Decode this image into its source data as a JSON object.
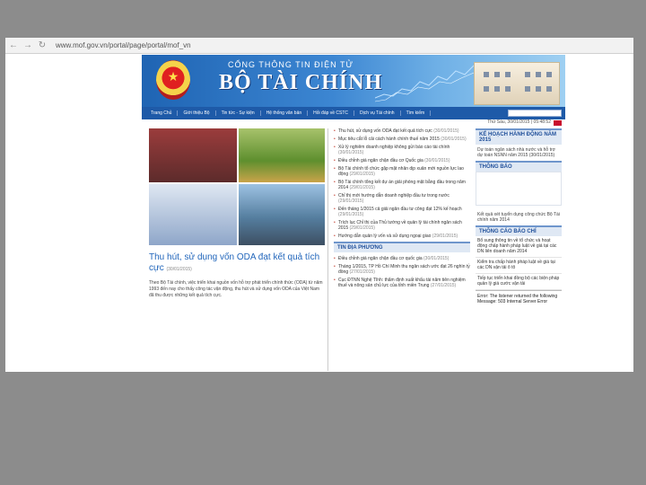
{
  "browser": {
    "url": "www.mof.gov.vn/portal/page/portal/mof_vn"
  },
  "banner": {
    "subtitle": "CỔNG THÔNG TIN ĐIỆN TỬ",
    "title": "BỘ TÀI CHÍNH"
  },
  "menu": {
    "items": [
      "Trang Chủ",
      "Giới thiệu Bộ",
      "Tin tức - Sự kiện",
      "Hệ thống văn bản",
      "Hỏi đáp về CSTC",
      "Dịch vụ Tài chính"
    ],
    "search_label": "Tìm kiếm"
  },
  "date": "Thứ Sáu, 30/01/2015 | 05:48:52",
  "lead": {
    "title": "Thu hút, sử dụng vốn ODA đạt kết quả tích cực",
    "date": "(30/01/2015)",
    "desc": "Theo Bộ Tài chính, việc triển khai nguồn vốn hỗ trợ phát triển chính thức (ODA) từ năm 1993 đến nay cho thấy công tác vận động, thu hút và sử dụng vốn ODA của Việt Nam đã thu được những kết quả tích cực."
  },
  "news": [
    {
      "text": "Thu hút, sử dụng vốn ODA đạt kết quả tích cực",
      "date": "(30/01/2015)"
    },
    {
      "text": "Mục tiêu cắt lỗ cải cách hành chính thuế năm 2015",
      "date": "(30/01/2015)"
    },
    {
      "text": "Xử lý nghiêm doanh nghiệp không gửi báo cáo tài chính",
      "date": "(30/01/2015)"
    },
    {
      "text": "Điều chỉnh giá ngăn chặn đầu cơ Quốc gia",
      "date": "(30/01/2015)"
    },
    {
      "text": "Bộ Tài chính tổ chức gặp mặt nhân dịp xuân mới nguồn lực lao động",
      "date": "(29/01/2015)"
    },
    {
      "text": "Bộ Tài chính tổng kết dự án giải phóng mặt bằng đầu trong năm 2014",
      "date": "(29/01/2015)"
    },
    {
      "text": "Chỉ thị mới hướng dẫn doanh nghiệp đầu tư trong nước",
      "date": "(29/01/2015)"
    },
    {
      "text": "Đến tháng 1/2015 cả giải ngân đầu tư công đạt 12% kế hoạch",
      "date": "(29/01/2015)"
    },
    {
      "text": "Trích lục Chỉ thị của Thủ tướng về quản lý tài chính ngân sách 2015",
      "date": "(29/01/2015)"
    },
    {
      "text": "Hướng dẫn quản lý vốn và sử dụng ngoại giao",
      "date": "(29/01/2015)"
    }
  ],
  "local_news": {
    "heading": "TIN ĐỊA PHƯƠNG",
    "items": [
      {
        "text": "Điều chỉnh giá ngăn chặn đầu cơ quốc gia",
        "date": "(30/01/2015)"
      },
      {
        "text": "Tháng 1/2015, TP Hồ Chí Minh thu ngân sách ước đạt 26 nghìn tỷ đồng",
        "date": "(27/01/2015)"
      },
      {
        "text": "Cục ĐTNN Nghệ Tĩnh: thẩm định xuất khẩu tài năm tiên nghiệm thuế và nông sản chủ lực của tỉnh miền Trung",
        "date": "(27/01/2015)"
      }
    ]
  },
  "right": {
    "plan_heading": "KẾ HOẠCH HÀNH ĐỘNG NĂM 2015",
    "plan_text": "Dự toán ngân sách nhà nước và hỗ trợ dự toán NSNN năm 2015 (30/01/2015)",
    "notice_heading": "THÔNG BÁO",
    "notice_text": "Kết quả xét tuyển dụng công chức Bộ Tài chính năm 2014",
    "press_heading": "THÔNG CÁO BÁO CHÍ",
    "press_items": [
      "Bổ sung thông tin về tổ chức và hoạt động chấp hành pháp luật về giá tại các DN liên doanh năm 2014",
      "Kiểm tra chấp hành pháp luật về giá tại các DN vận tải ô tô",
      "Tiếp tục triển khai đồng bộ các biện pháp quản lý giá cước vận tải"
    ],
    "error": "Error: The listener returned the following Message: 503 Internal Server Error"
  }
}
